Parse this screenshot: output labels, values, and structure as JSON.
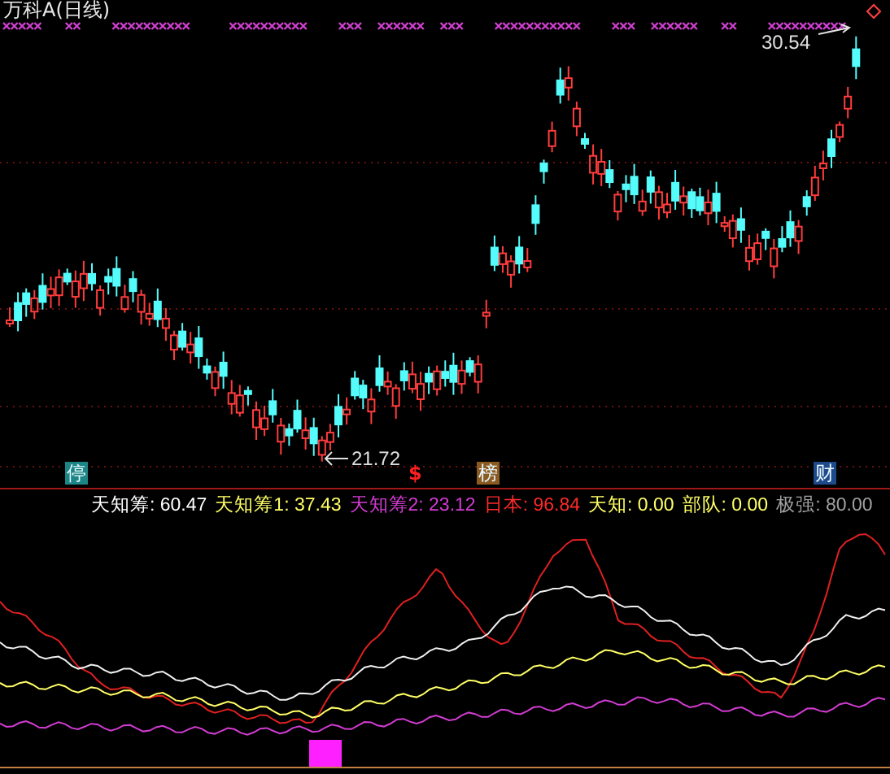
{
  "chart": {
    "title": "万科A(日线)",
    "high_label": "30.54",
    "low_label": "21.72",
    "markers": [
      {
        "text": "停",
        "kind": "badge",
        "color": "#1c8585"
      },
      {
        "text": "$",
        "kind": "glyph",
        "color": "#ff2020"
      },
      {
        "text": "榜",
        "kind": "badge",
        "color": "#8a5a20"
      },
      {
        "text": "财",
        "kind": "badge",
        "color": "#1d4a8a"
      }
    ]
  },
  "indicator": {
    "values": [
      {
        "text": "天知筹: 60.47",
        "color": "#ffffff"
      },
      {
        "text": "天知筹1: 37.43",
        "color": "#ffff66"
      },
      {
        "text": "天知筹2: 23.12",
        "color": "#d23cd2"
      },
      {
        "text": "日本: 96.84",
        "color": "#ff2a2a"
      },
      {
        "text": "天知: 0.00",
        "color": "#ffff66"
      },
      {
        "text": "部队: 0.00",
        "color": "#ffff66"
      },
      {
        "text": "极强: 80.00",
        "color": "#a0a0a0"
      }
    ]
  }
}
